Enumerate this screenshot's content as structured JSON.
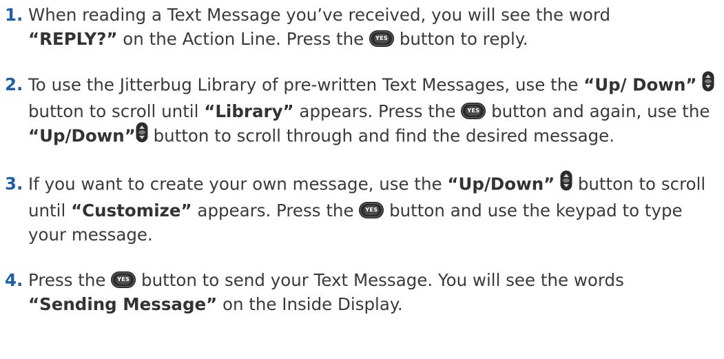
{
  "icons": {
    "yes": "yes-button-icon",
    "updown": "up-down-button-icon",
    "yes_label": "YES"
  },
  "colors": {
    "step_number": "#1f5ea8",
    "text": "#3a3a3a"
  },
  "steps": [
    {
      "number": "1.",
      "p1": "When reading a Text Message you’ve received, you will see the word",
      "b1": "“REPLY?”",
      "p2": " on the Action Line. Press the ",
      "p3": " button to reply."
    },
    {
      "number": "2.",
      "p1": "To use the Jitterbug Library of pre-written Text Messages, use the ",
      "b1": "“Up/ Down”",
      "p2": " button to scroll until ",
      "b2": "“Library”",
      "p3": " appears. Press the ",
      "p4": " button and again, use the ",
      "b3": "“Up/Down”",
      "p5": " button to scroll through and find the desired message."
    },
    {
      "number": "3.",
      "p1": "If you want to create your own message, use the ",
      "b1": "“Up/Down”",
      "p2": " button to scroll until ",
      "b2": "“Customize”",
      "p3": " appears. Press the ",
      "p4": " button and use the keypad to type your message."
    },
    {
      "number": "4.",
      "p1": "Press the ",
      "p2": " button to send your Text Message. You will see the words",
      "b1": "“Sending Message”",
      "p3": " on the Inside Display."
    }
  ]
}
